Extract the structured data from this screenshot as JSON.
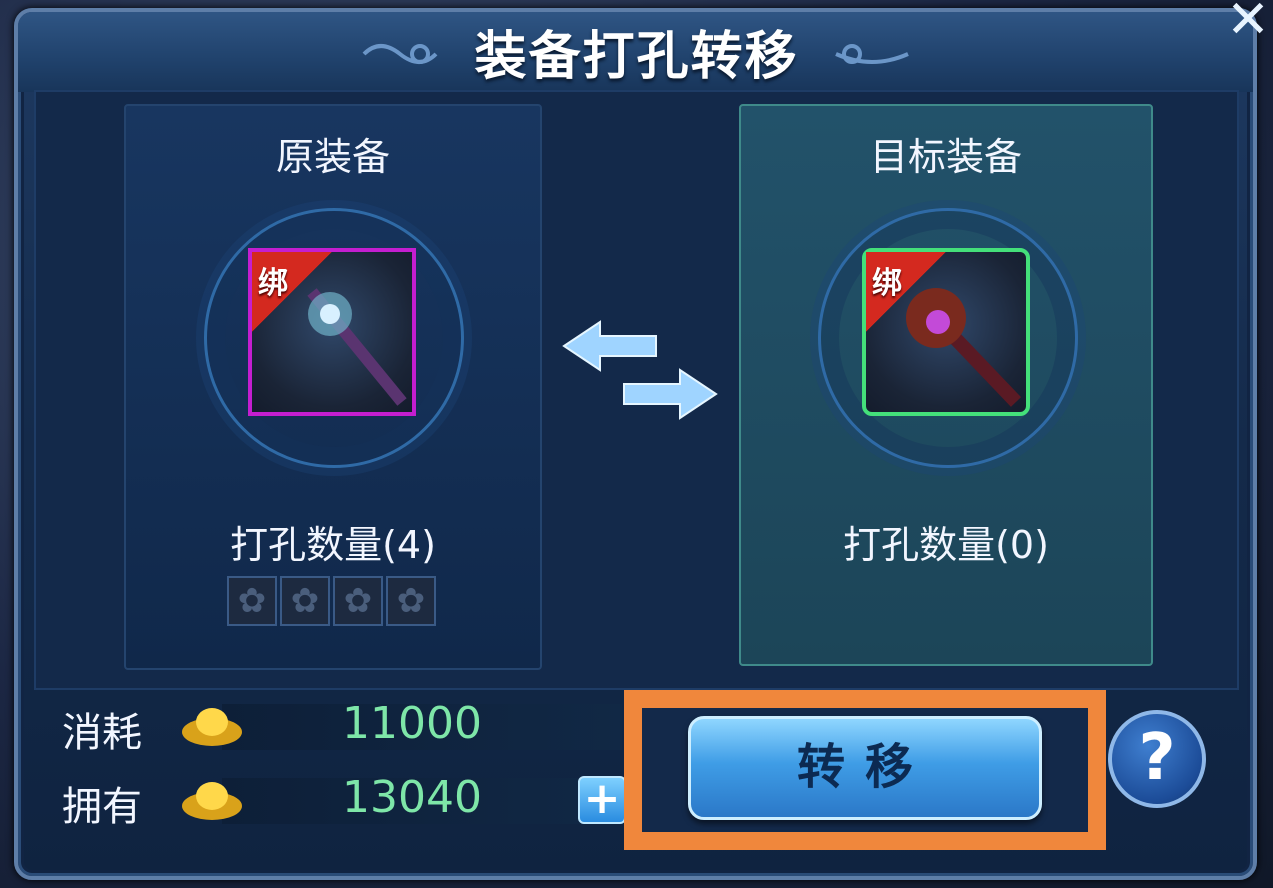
{
  "dialog": {
    "title": "装备打孔转移",
    "close_icon": "close-icon"
  },
  "source": {
    "header": "原装备",
    "bind_label": "绑",
    "holes_label": "打孔数量(4)",
    "sockets": [
      "empty",
      "empty",
      "empty",
      "empty"
    ],
    "frame_color": "#c41ed0"
  },
  "target": {
    "header": "目标装备",
    "bind_label": "绑",
    "holes_label": "打孔数量(0)",
    "frame_color": "#44e07a"
  },
  "resources": {
    "cost_label": "消耗",
    "cost_value": "11000",
    "owned_label": "拥有",
    "owned_value": "13040",
    "currency_icon": "gold-ingot-icon",
    "add_label": "+"
  },
  "actions": {
    "transfer_label": "转移",
    "help_label": "?",
    "highlight_color": "#f0873c"
  }
}
